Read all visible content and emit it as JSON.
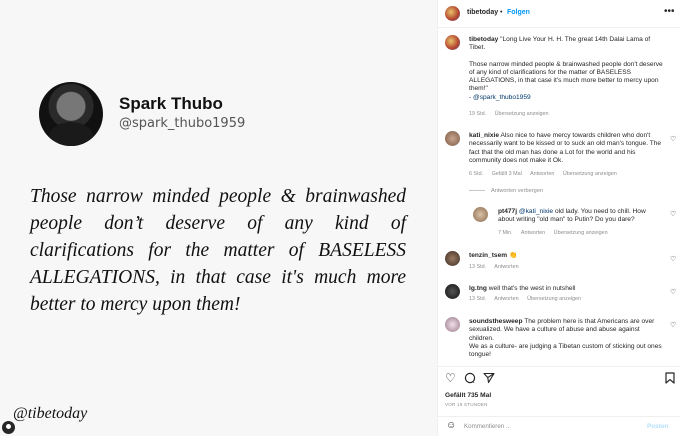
{
  "post_image": {
    "display_name": "Spark Thubo",
    "handle": "@spark_thubo1959",
    "quote_lines": [
      "Those narrow minded people & brainwashed",
      "people don’t deserve of any kind of",
      "clarifications for the matter of BASELESS",
      "ALLEGATIONS, in that case it's much more",
      "better to mercy upon them!"
    ],
    "watermark": "@tibetoday"
  },
  "header": {
    "username": "tibetoday",
    "separator": "•",
    "follow_label": "Folgen",
    "more_icon": "more-horizontal-icon"
  },
  "caption": {
    "username": "tibetoday",
    "line1": "\"Long Live Your H. H. The great 14th Dalai Lama of Tibet.",
    "line2": "Those narrow minded people & brainwashed people don't deserve of any kind of clarifications for the matter of BASELESS ALLEGATIONS, in that case it's much more better to mercy upon them!\"",
    "credit": "- @spark_thubo1959",
    "time": "19 Std.",
    "translate": "Übersetzung anzeigen"
  },
  "comments": [
    {
      "username": "kati_nixie",
      "text": "Also nice to have mercy towards children who don't necessarily want to be kissed or to suck an old man's tongue. The fact that the old man has done a Lot for the world and his community does not make it Ok.",
      "time": "6 Std.",
      "likes": "Gefällt 3 Mal",
      "reply": "Antworten",
      "translate": "Übersetzung anzeigen",
      "hide_replies": "Antworten verbergen"
    },
    {
      "username": "pt477j",
      "mention": "@kati_nixie",
      "text": "old lady. You need to chill. How about writing \"old man\" to Putin? Do you dare?",
      "time": "7 Min.",
      "reply": "Antworten",
      "translate": "Übersetzung anzeigen"
    },
    {
      "username": "tenzin_tsem",
      "text": "👏",
      "time": "13 Std.",
      "reply": "Antworten"
    },
    {
      "username": "lg.tng",
      "text": "well that's the west in nutshell",
      "time": "13 Std.",
      "reply": "Antworten",
      "translate": "Übersetzung anzeigen"
    },
    {
      "username": "soundsthesweep",
      "text": "The problem here is that Americans are over sexualized. We have a culture of abuse and abuse against children.",
      "text2": "We as a culture- are judging a Tibetan custom of sticking out ones tongue!"
    }
  ],
  "actions": {
    "like_icon": "heart-icon",
    "comment_icon": "comment-icon",
    "share_icon": "paper-plane-icon",
    "save_icon": "bookmark-icon",
    "likes": "Gefällt 735 Mal",
    "ago": "VOR 19 STUNDEN"
  },
  "add_comment": {
    "emoji_icon": "smiley-icon",
    "placeholder": "Kommentieren ...",
    "post_label": "Posten"
  }
}
